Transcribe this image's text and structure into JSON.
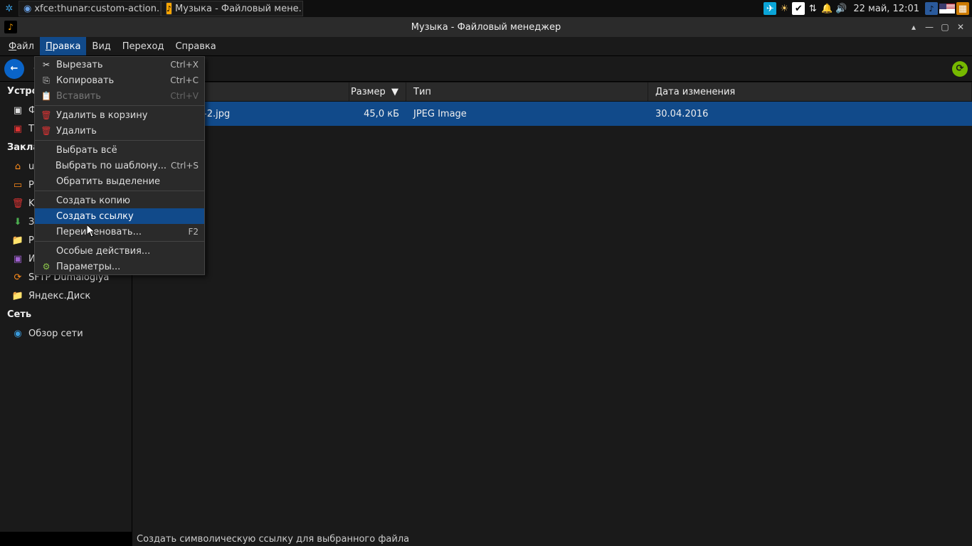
{
  "panel": {
    "task1": "xfce:thunar:custom-action...",
    "task2": "Музыка - Файловый мене...",
    "clock": "22 май, 12:01"
  },
  "window": {
    "title": "Музыка - Файловый менеджер"
  },
  "menubar": {
    "file": "Файл",
    "edit": "Правка",
    "view": "Вид",
    "go": "Переход",
    "help": "Справка"
  },
  "dropdown": {
    "cut": "Вырезать",
    "cut_accel": "Ctrl+X",
    "copy": "Копировать",
    "copy_accel": "Ctrl+C",
    "paste": "Вставить",
    "paste_accel": "Ctrl+V",
    "trash": "Удалить в корзину",
    "delete": "Удалить",
    "select_all": "Выбрать всё",
    "select_pattern": "Выбрать по шаблону...",
    "select_pattern_accel": "Ctrl+S",
    "invert": "Обратить выделение",
    "duplicate": "Создать копию",
    "make_link": "Создать ссылку",
    "rename": "Переименовать...",
    "rename_accel": "F2",
    "custom_actions": "Особые действия...",
    "preferences": "Параметры..."
  },
  "side": {
    "devices_hdr": "Устро",
    "dev1": "Ф",
    "dev2": "T",
    "bookmarks_hdr": "Закла",
    "u_item": "u",
    "p_item": "P",
    "k_item": "K",
    "z_item": "З",
    "p2_item": "P",
    "i_item": "И",
    "sftp": "SFTP Dumalogiya",
    "yadisk": "Яндекс.Диск",
    "network_hdr": "Сеть",
    "browse": "Обзор сети"
  },
  "columns": {
    "name": "",
    "size": "Размер",
    "type": "Тип",
    "date": "Дата изменения"
  },
  "files": [
    {
      "name": "-2.jpg",
      "size": "45,0 кБ",
      "type": "JPEG Image",
      "date": "30.04.2016"
    }
  ],
  "statusbar": "Создать символическую ссылку для выбранного файла"
}
